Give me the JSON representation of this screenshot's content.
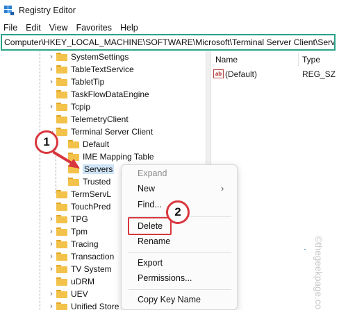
{
  "window": {
    "title": "Registry Editor",
    "icon": "registry-editor-icon"
  },
  "menu": [
    "File",
    "Edit",
    "View",
    "Favorites",
    "Help"
  ],
  "address": "Computer\\HKEY_LOCAL_MACHINE\\SOFTWARE\\Microsoft\\Terminal Server Client\\Servers",
  "tree": [
    {
      "label": "SystemSettings",
      "top": 1
    },
    {
      "label": "TableTextService"
    },
    {
      "label": "TabletTip"
    },
    {
      "label": "TaskFlowDataEngine"
    },
    {
      "label": "Tcpip"
    },
    {
      "label": "TelemetryClient"
    },
    {
      "label": "Terminal Server Client",
      "expanded": true
    },
    {
      "label": "Default"
    },
    {
      "label": "IME Mapping Table"
    },
    {
      "label": "Servers",
      "selected": true
    },
    {
      "label": "Trusted"
    },
    {
      "label": "TermServL"
    },
    {
      "label": "TouchPred"
    },
    {
      "label": "TPG"
    },
    {
      "label": "Tpm"
    },
    {
      "label": "Tracing"
    },
    {
      "label": "Transaction"
    },
    {
      "label": "TV System"
    },
    {
      "label": "uDRM"
    },
    {
      "label": "UEV"
    },
    {
      "label": "Unified Store"
    }
  ],
  "values_pane": {
    "columns": {
      "name": "Name",
      "type": "Type"
    },
    "rows": [
      {
        "name": "(Default)",
        "type": "REG_SZ",
        "icon": "string-value-icon"
      }
    ]
  },
  "context_menu": {
    "items": [
      {
        "label": "Expand",
        "disabled": true
      },
      {
        "label": "New",
        "submenu": true
      },
      {
        "label": "Find..."
      },
      {
        "label": "Delete"
      },
      {
        "label": "Rename"
      },
      {
        "label": "Export"
      },
      {
        "label": "Permissions..."
      },
      {
        "label": "Copy Key Name"
      }
    ]
  },
  "annotations": {
    "step1": "1",
    "step2": "2",
    "highlight_color": "#d9363e"
  },
  "watermark": "©thegeekpage.com",
  "colors": {
    "address_border": "#2aa388",
    "selection": "#cfe3f6",
    "folder": "#f3c24a"
  }
}
